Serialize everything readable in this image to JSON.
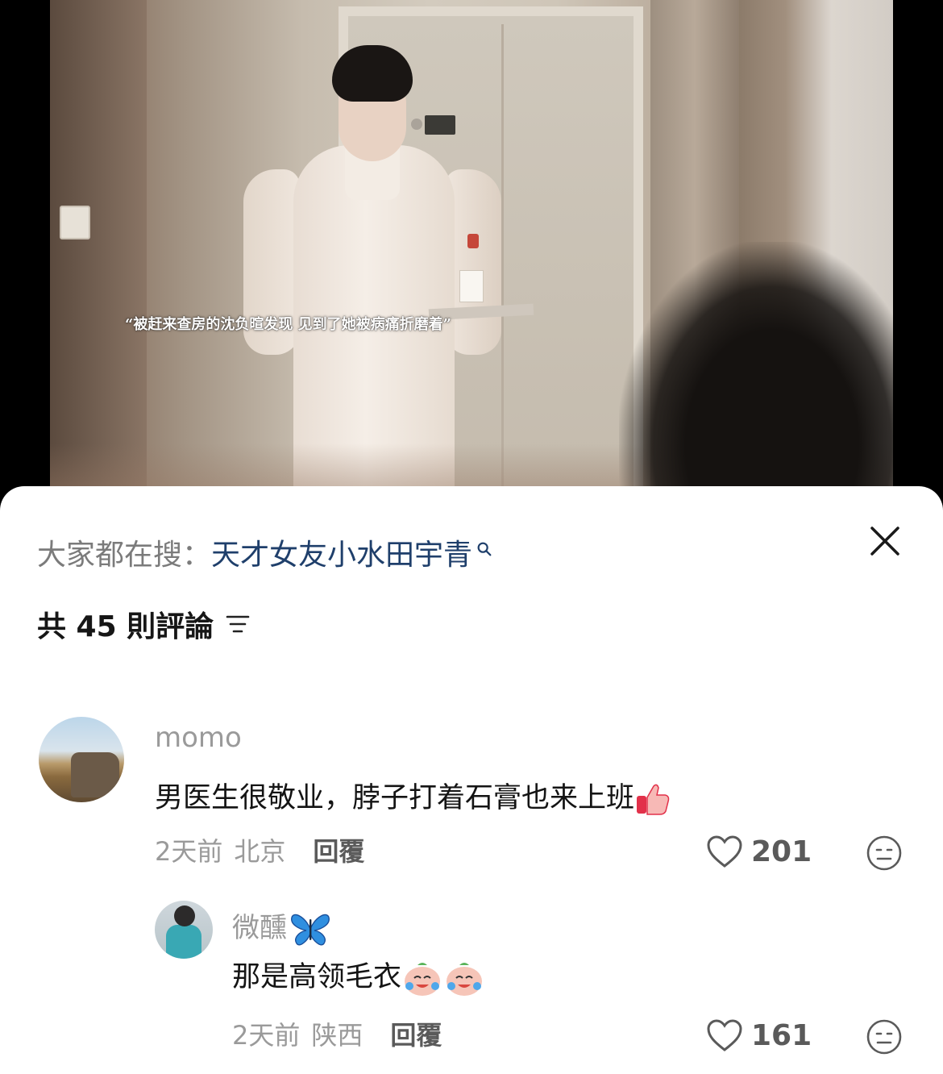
{
  "video": {
    "subtitle": "“被赶来查房的沈负暄发现 见到了她被病痛折磨着”"
  },
  "sheet": {
    "search_prefix": "大家都在搜：",
    "search_term": "天才女友小水田宇青",
    "comment_count_label": "共 45 則評論"
  },
  "comments": [
    {
      "username": "momo",
      "text": "男医生很敬业，脖子打着石膏也来上班",
      "emoji": "thumbs-up",
      "time": "2天前",
      "location": "北京",
      "reply_label": "回覆",
      "likes": "201",
      "avatar": "landscape-rock-avatar"
    },
    {
      "username": "微醺",
      "username_emoji": "butterfly",
      "text": "那是高领毛衣",
      "emoji": "crying-laughing-peach",
      "time": "2天前",
      "location": "陕西",
      "reply_label": "回覆",
      "likes": "161",
      "avatar": "person-teal-jacket-avatar"
    }
  ],
  "colors": {
    "search_term": "#1f3f6b",
    "muted": "#9a9a9a",
    "text": "#141414"
  }
}
